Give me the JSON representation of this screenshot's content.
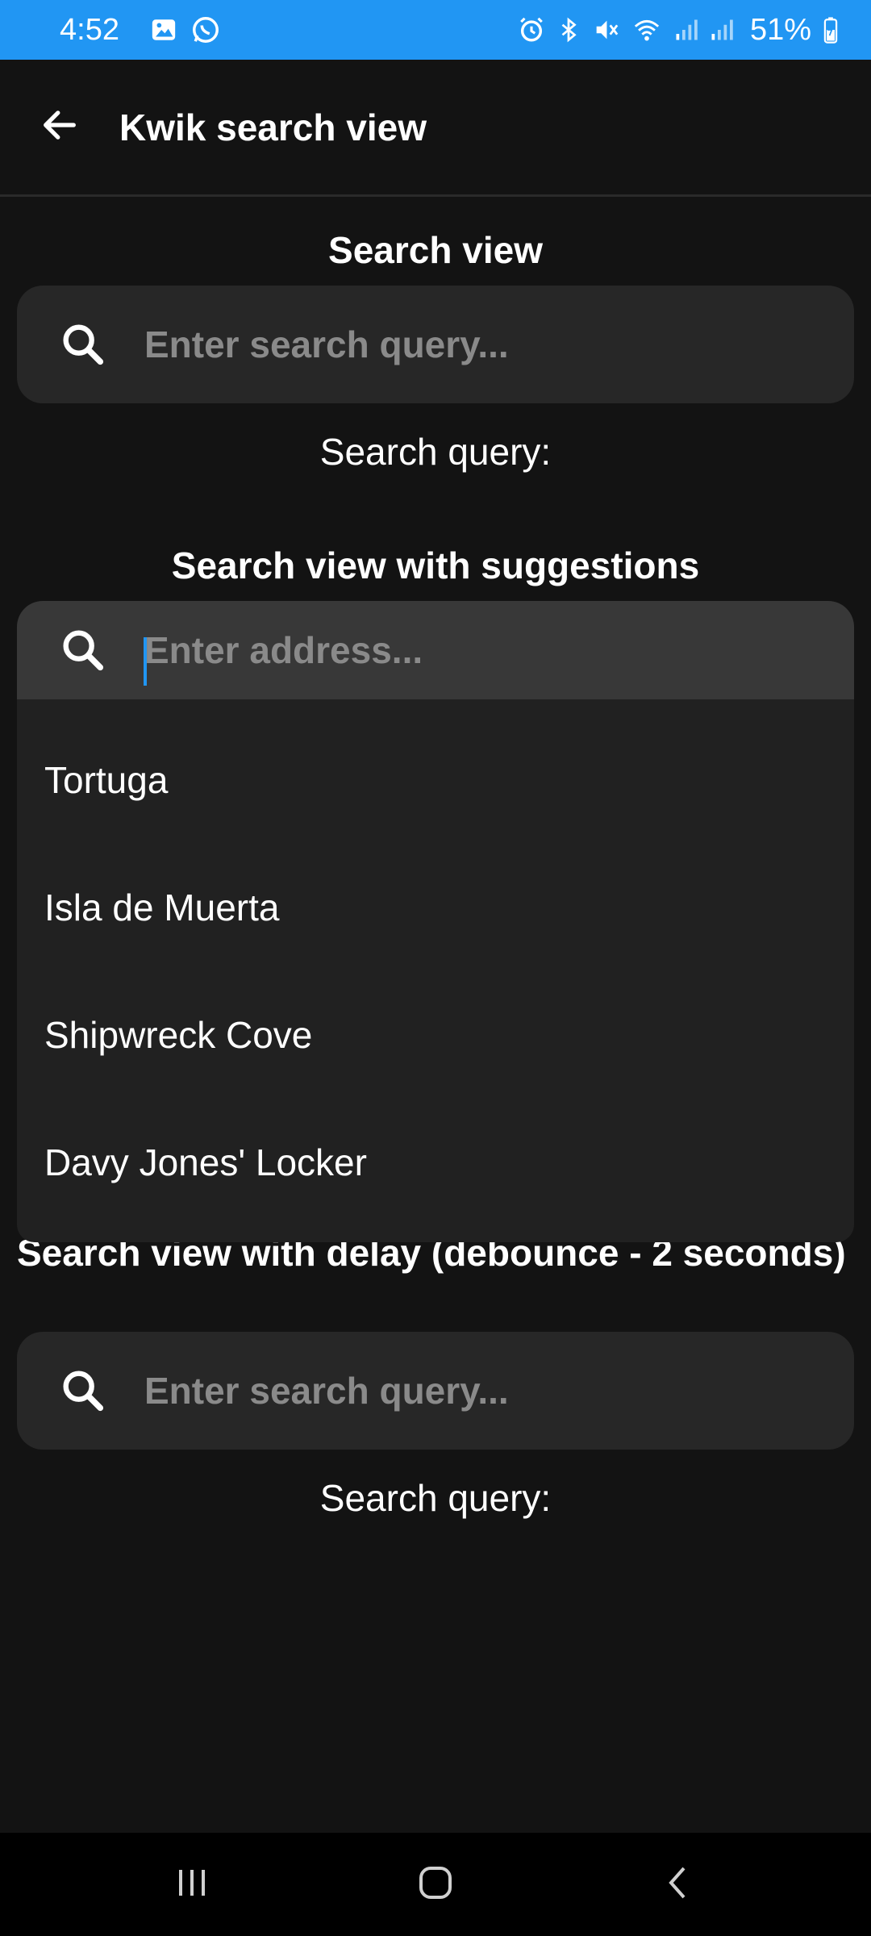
{
  "status_bar": {
    "time": "4:52",
    "battery": "51%",
    "accent": "#2196f3"
  },
  "app_bar": {
    "title": "Kwik search view"
  },
  "section1": {
    "title": "Search view",
    "placeholder": "Enter search query...",
    "query_label": "Search query:"
  },
  "section2": {
    "title": "Search view with suggestions",
    "placeholder": "Enter address...",
    "suggestions": [
      "Tortuga",
      "Isla de Muerta",
      "Shipwreck Cove",
      "Davy Jones' Locker"
    ]
  },
  "section3": {
    "title": "Search view with delay (debounce - 2 seconds)",
    "placeholder": "Enter search query...",
    "query_label": "Search query:"
  },
  "icons": {
    "search": "search-icon",
    "back": "arrow-back-icon"
  }
}
